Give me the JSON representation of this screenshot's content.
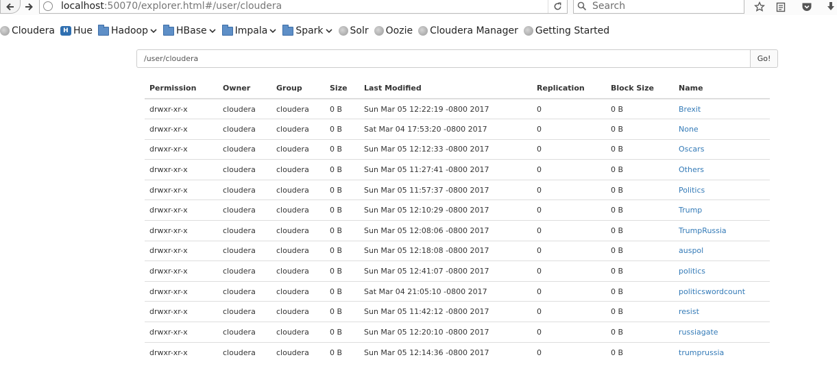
{
  "browser": {
    "url_host": "localhost",
    "url_path": ":50070/explorer.html#/user/cloudera",
    "search_placeholder": "Search"
  },
  "bookmarks": [
    {
      "label": "Cloudera",
      "icon": "globe-icon",
      "dropdown": false
    },
    {
      "label": "Hue",
      "icon": "hue-icon",
      "dropdown": false
    },
    {
      "label": "Hadoop",
      "icon": "folder-icon",
      "dropdown": true
    },
    {
      "label": "HBase",
      "icon": "folder-icon",
      "dropdown": true
    },
    {
      "label": "Impala",
      "icon": "folder-icon",
      "dropdown": true
    },
    {
      "label": "Spark",
      "icon": "folder-icon",
      "dropdown": true
    },
    {
      "label": "Solr",
      "icon": "globe-icon",
      "dropdown": false
    },
    {
      "label": "Oozie",
      "icon": "globe-icon",
      "dropdown": false
    },
    {
      "label": "Cloudera Manager",
      "icon": "globe-icon",
      "dropdown": false
    },
    {
      "label": "Getting Started",
      "icon": "globe-icon",
      "dropdown": false
    }
  ],
  "explorer": {
    "directory_value": "/user/cloudera",
    "go_label": "Go!",
    "columns": [
      "Permission",
      "Owner",
      "Group",
      "Size",
      "Last Modified",
      "Replication",
      "Block Size",
      "Name"
    ],
    "rows": [
      [
        "drwxr-xr-x",
        "cloudera",
        "cloudera",
        "0 B",
        "Sun Mar 05 12:22:19 -0800 2017",
        "0",
        "0 B",
        "Brexit"
      ],
      [
        "drwxr-xr-x",
        "cloudera",
        "cloudera",
        "0 B",
        "Sat Mar 04 17:53:20 -0800 2017",
        "0",
        "0 B",
        "None"
      ],
      [
        "drwxr-xr-x",
        "cloudera",
        "cloudera",
        "0 B",
        "Sun Mar 05 12:12:33 -0800 2017",
        "0",
        "0 B",
        "Oscars"
      ],
      [
        "drwxr-xr-x",
        "cloudera",
        "cloudera",
        "0 B",
        "Sun Mar 05 11:27:41 -0800 2017",
        "0",
        "0 B",
        "Others"
      ],
      [
        "drwxr-xr-x",
        "cloudera",
        "cloudera",
        "0 B",
        "Sun Mar 05 11:57:37 -0800 2017",
        "0",
        "0 B",
        "Politics"
      ],
      [
        "drwxr-xr-x",
        "cloudera",
        "cloudera",
        "0 B",
        "Sun Mar 05 12:10:29 -0800 2017",
        "0",
        "0 B",
        "Trump"
      ],
      [
        "drwxr-xr-x",
        "cloudera",
        "cloudera",
        "0 B",
        "Sun Mar 05 12:08:06 -0800 2017",
        "0",
        "0 B",
        "TrumpRussia"
      ],
      [
        "drwxr-xr-x",
        "cloudera",
        "cloudera",
        "0 B",
        "Sun Mar 05 12:18:08 -0800 2017",
        "0",
        "0 B",
        "auspol"
      ],
      [
        "drwxr-xr-x",
        "cloudera",
        "cloudera",
        "0 B",
        "Sun Mar 05 12:41:07 -0800 2017",
        "0",
        "0 B",
        "politics"
      ],
      [
        "drwxr-xr-x",
        "cloudera",
        "cloudera",
        "0 B",
        "Sat Mar 04 21:05:10 -0800 2017",
        "0",
        "0 B",
        "politicswordcount"
      ],
      [
        "drwxr-xr-x",
        "cloudera",
        "cloudera",
        "0 B",
        "Sun Mar 05 11:42:12 -0800 2017",
        "0",
        "0 B",
        "resist"
      ],
      [
        "drwxr-xr-x",
        "cloudera",
        "cloudera",
        "0 B",
        "Sun Mar 05 12:20:10 -0800 2017",
        "0",
        "0 B",
        "russiagate"
      ],
      [
        "drwxr-xr-x",
        "cloudera",
        "cloudera",
        "0 B",
        "Sun Mar 05 12:14:36 -0800 2017",
        "0",
        "0 B",
        "trumprussia"
      ]
    ]
  },
  "colors": {
    "link": "#337ab7",
    "folder": "#5e8fc7",
    "border": "#dddddd"
  }
}
